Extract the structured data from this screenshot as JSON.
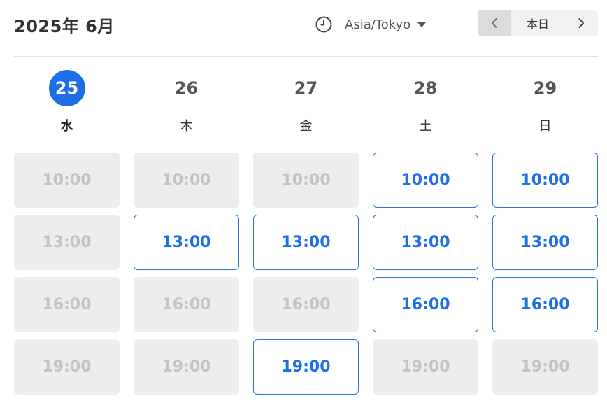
{
  "header": {
    "month_title": "2025年 6月",
    "timezone": "Asia/Tokyo",
    "today_label": "本日",
    "prev_icon": "chevron-left-icon",
    "next_icon": "chevron-right-icon",
    "clock_icon": "clock-icon"
  },
  "colors": {
    "accent": "#1e6fe6",
    "disabled_bg": "#ededed",
    "disabled_text": "#c4c4c4"
  },
  "days": [
    {
      "date": "25",
      "weekday": "水",
      "today": true,
      "slots": [
        {
          "time": "10:00",
          "available": false
        },
        {
          "time": "13:00",
          "available": false
        },
        {
          "time": "16:00",
          "available": false
        },
        {
          "time": "19:00",
          "available": false
        }
      ]
    },
    {
      "date": "26",
      "weekday": "木",
      "today": false,
      "slots": [
        {
          "time": "10:00",
          "available": false
        },
        {
          "time": "13:00",
          "available": true
        },
        {
          "time": "16:00",
          "available": false
        },
        {
          "time": "19:00",
          "available": false
        }
      ]
    },
    {
      "date": "27",
      "weekday": "金",
      "today": false,
      "slots": [
        {
          "time": "10:00",
          "available": false
        },
        {
          "time": "13:00",
          "available": true
        },
        {
          "time": "16:00",
          "available": false
        },
        {
          "time": "19:00",
          "available": true
        }
      ]
    },
    {
      "date": "28",
      "weekday": "土",
      "today": false,
      "slots": [
        {
          "time": "10:00",
          "available": true
        },
        {
          "time": "13:00",
          "available": true
        },
        {
          "time": "16:00",
          "available": true
        },
        {
          "time": "19:00",
          "available": false
        }
      ]
    },
    {
      "date": "29",
      "weekday": "日",
      "today": false,
      "slots": [
        {
          "time": "10:00",
          "available": true
        },
        {
          "time": "13:00",
          "available": true
        },
        {
          "time": "16:00",
          "available": true
        },
        {
          "time": "19:00",
          "available": false
        }
      ]
    }
  ]
}
